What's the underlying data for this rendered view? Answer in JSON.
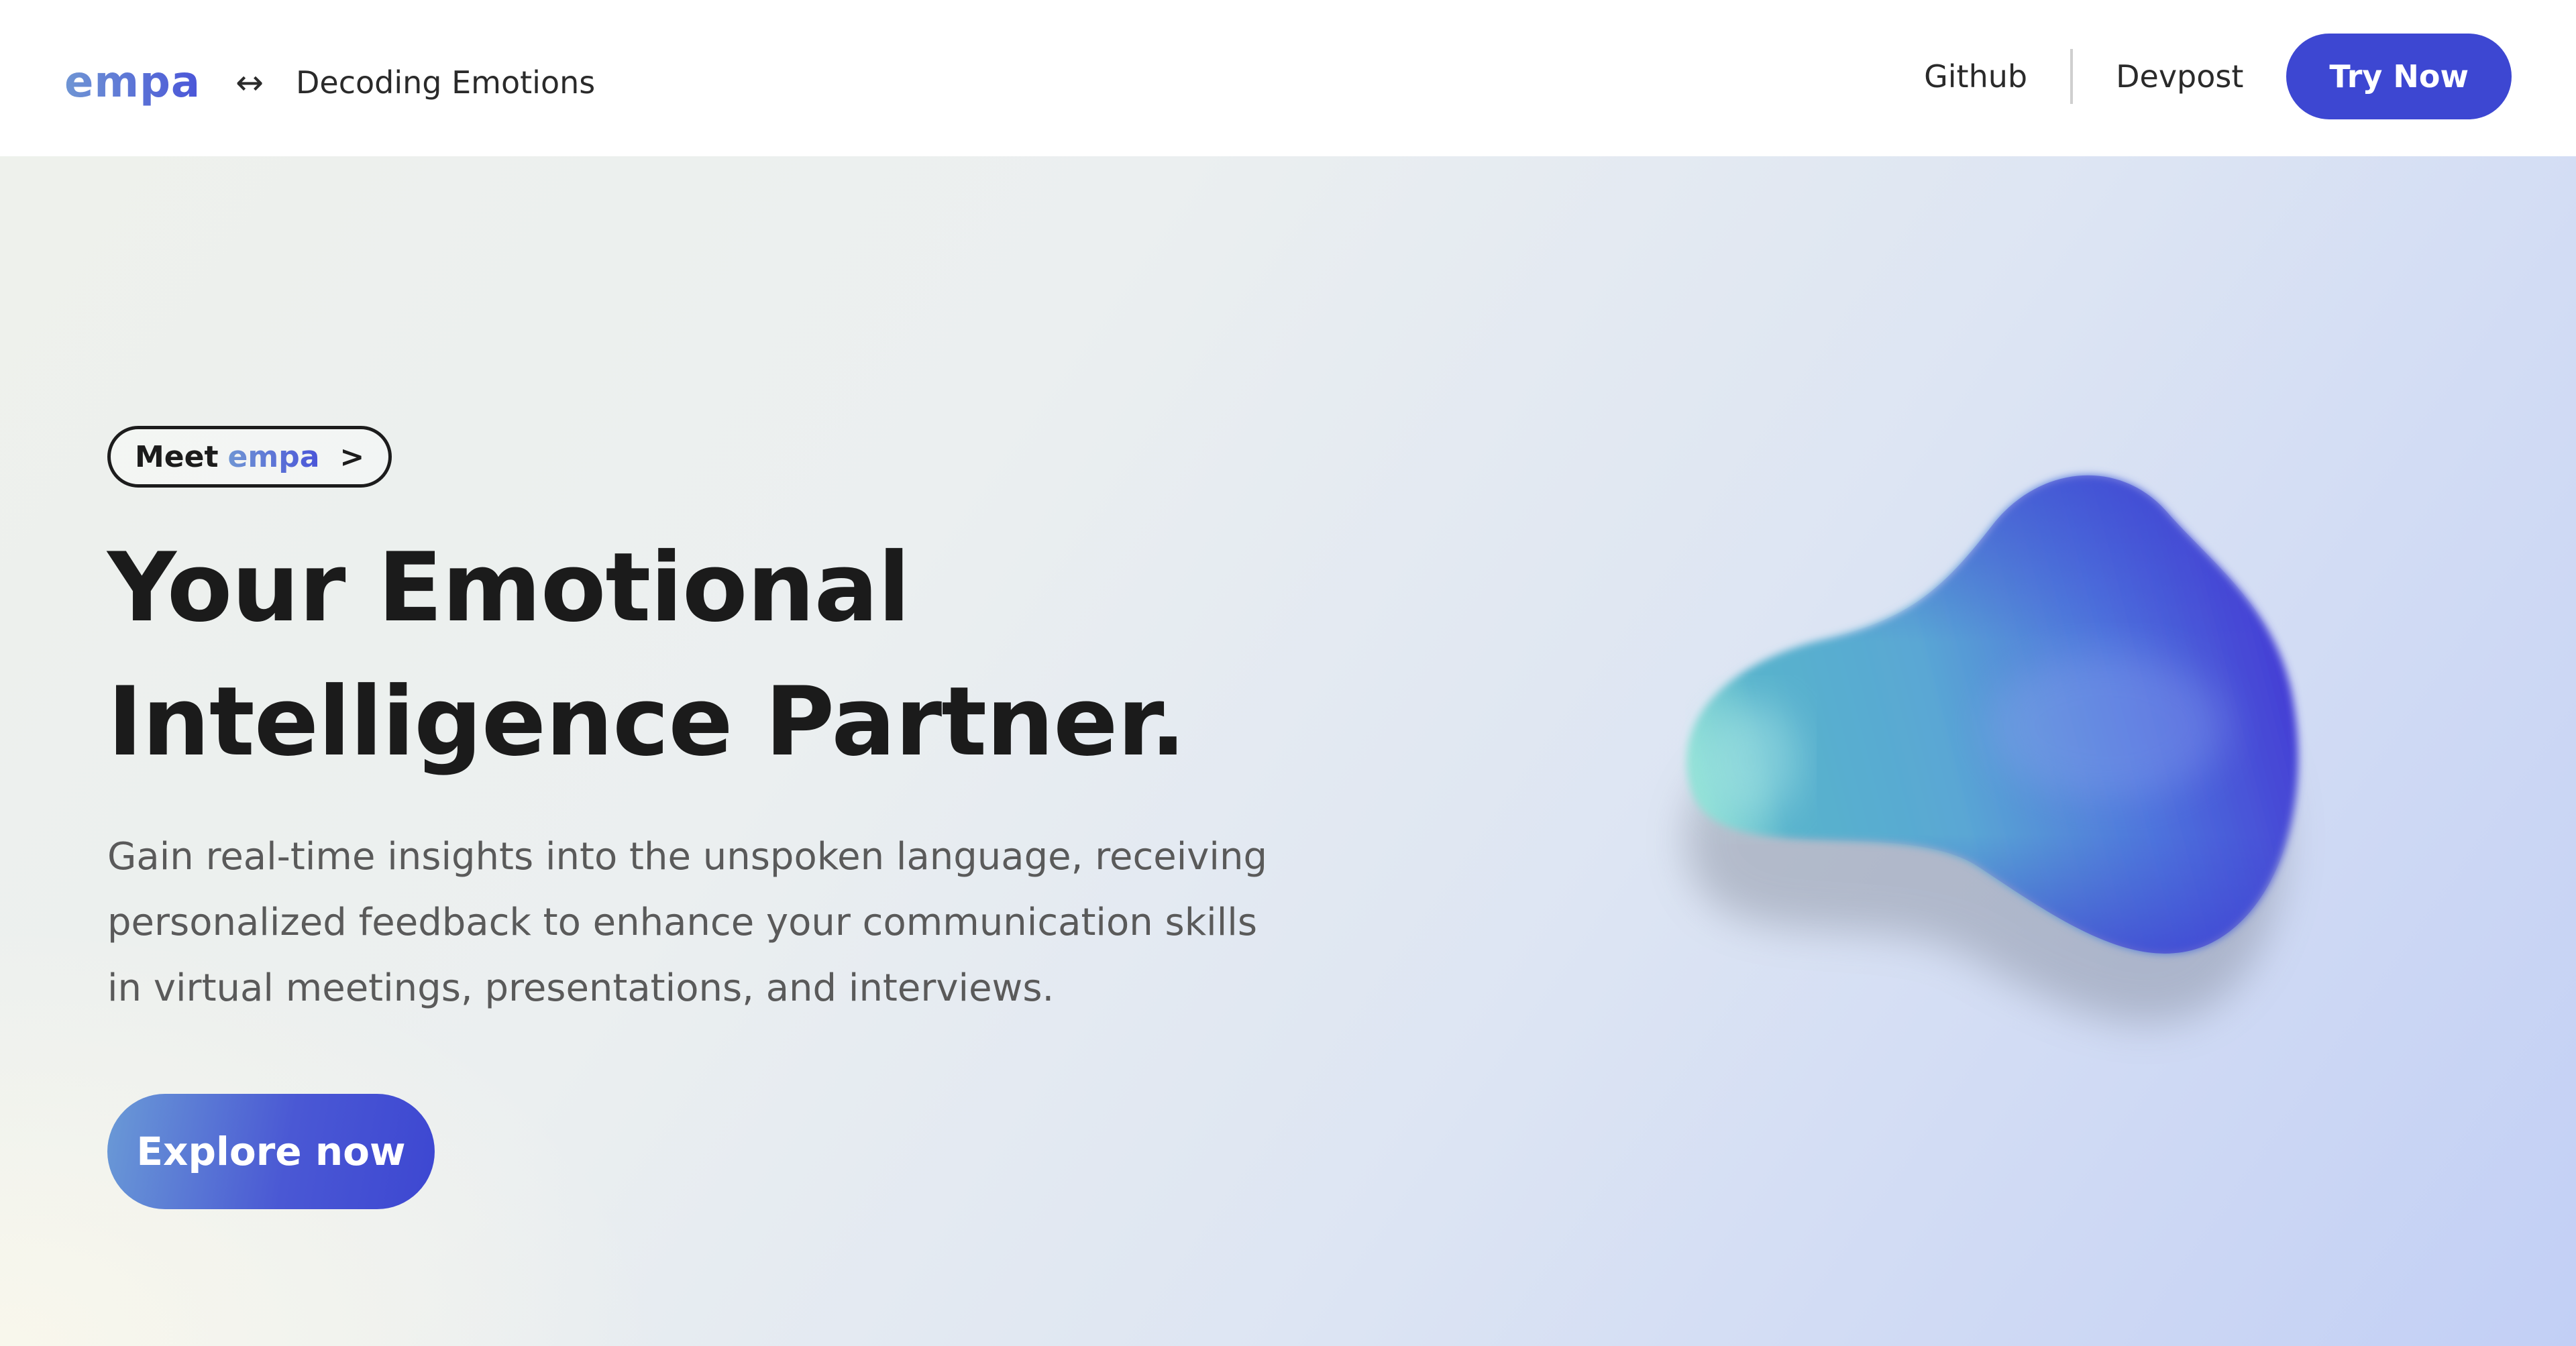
{
  "header": {
    "logo": "empa",
    "swap_icon": "↔",
    "tagline": "Decoding Emotions",
    "nav": {
      "github": "Github",
      "devpost": "Devpost",
      "try_now": "Try Now"
    }
  },
  "hero": {
    "pill": {
      "meet": "Meet",
      "brand": "empa",
      "chevron": ">"
    },
    "headline_line1": "Your Emotional",
    "headline_line2": "Intelligence Partner.",
    "subtitle": "Gain real-time insights into the unspoken language, receiving personalized feedback to enhance your communication skills in virtual meetings, presentations, and interviews.",
    "cta": "Explore now"
  },
  "colors": {
    "accent": "#3d47d2",
    "logo_gradient_start": "#6f95d4",
    "logo_gradient_end": "#4a55d8",
    "hero_bg_left": "#eef1ec",
    "hero_bg_right": "#c2cff5"
  }
}
